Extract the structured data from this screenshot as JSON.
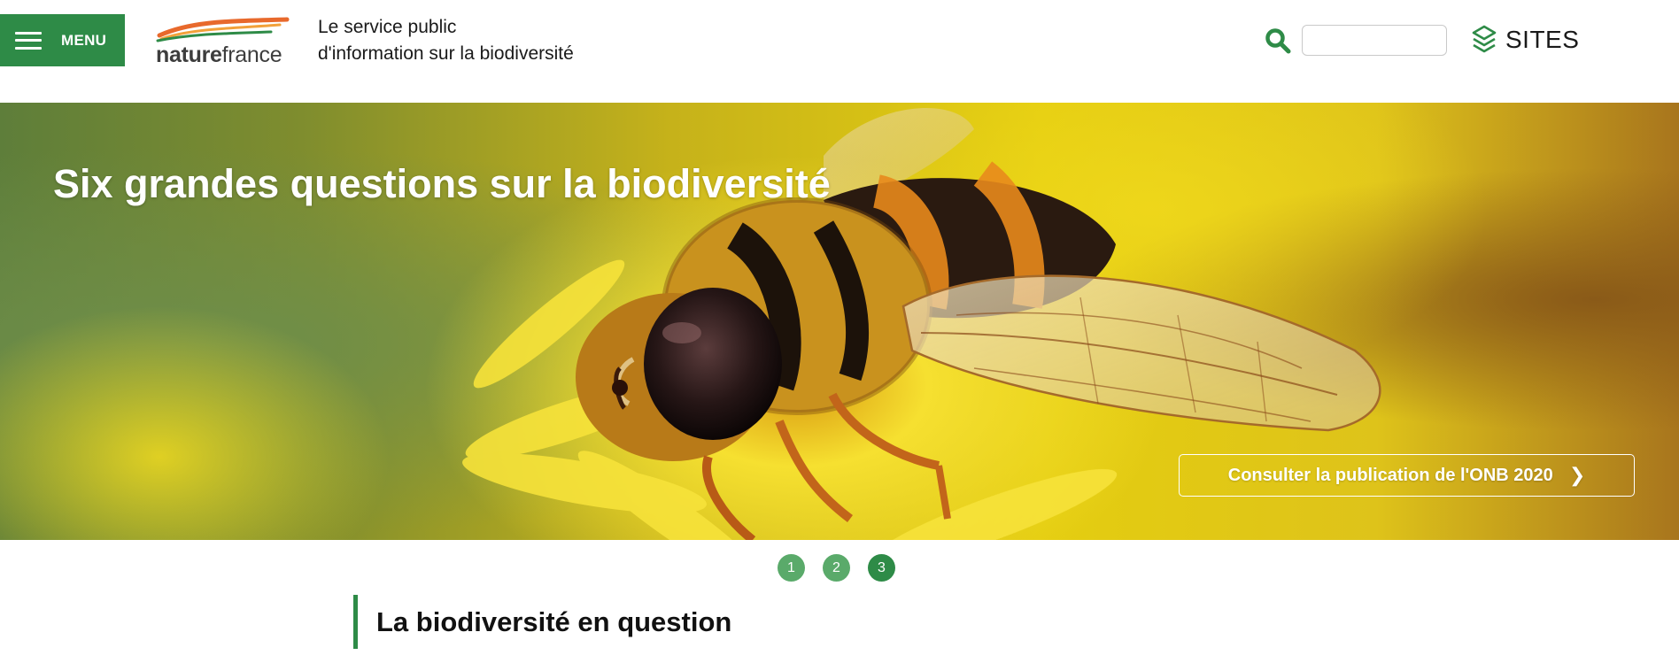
{
  "header": {
    "menu_label": "MENU",
    "logo": {
      "text_bold": "nature",
      "text_light": "france"
    },
    "tagline_line1": "Le service public",
    "tagline_line2": "d'information sur la biodiversité",
    "search": {
      "placeholder": "",
      "value": ""
    },
    "sites_label": "SITES"
  },
  "hero": {
    "title": "Six grandes questions sur la biodiversité",
    "cta_label": "Consulter la publication de l'ONB 2020",
    "image_subject": "hoverfly on yellow flower"
  },
  "pager": {
    "pages": [
      "1",
      "2",
      "3"
    ],
    "active_index": 2
  },
  "section": {
    "title": "La biodiversité en question"
  },
  "colors": {
    "brand_green": "#2e8b47",
    "pager_green": "#5aaa6a",
    "logo_orange": "#e8692c",
    "logo_green": "#2e8b47"
  },
  "icons": {
    "menu": "hamburger-icon",
    "search": "search-icon",
    "sites": "layers-icon",
    "cta": "chevron-right-icon"
  }
}
